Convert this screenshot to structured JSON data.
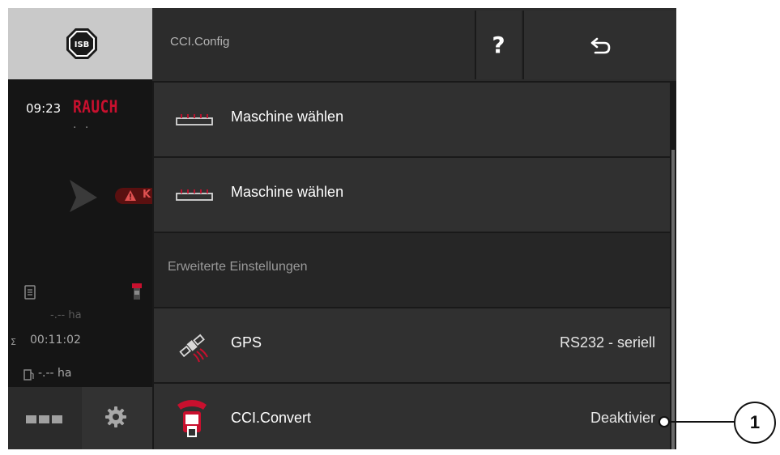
{
  "colors": {
    "brand": "#c8102e",
    "isb_tile": "#c9c9c9",
    "header_bg": "#2c2c2c",
    "row_bg": "#303030",
    "section_bg": "#262626",
    "text_primary": "#ffffff"
  },
  "sidebar": {
    "isb_label": "ISB",
    "time": "09:23",
    "brand": "RAUCH",
    "dots": "· ·",
    "alarm_text": "K",
    "area_top": "-.-- ha",
    "counter_symbol": "Σ",
    "counter": "00:11:02",
    "area_bottom": "-.-- ha",
    "icons": [
      "isb-icon",
      "navigation-arrow-icon",
      "warning-icon",
      "document-icon",
      "sprayer-icon",
      "sum-counter-icon",
      "fuel-icon",
      "grid-menu-icon",
      "gear-icon"
    ]
  },
  "header": {
    "title": "CCI.Config",
    "help_label": "?",
    "back_icon": "back-arrow-icon"
  },
  "list": {
    "items": [
      {
        "label": "Maschine wählen",
        "icon": "implement-icon"
      },
      {
        "label": "Maschine wählen",
        "icon": "implement-icon"
      }
    ],
    "section_label": "Erweiterte Einstellungen",
    "settings": [
      {
        "label": "GPS",
        "value": "RS232 - seriell",
        "icon": "gps-satellite-icon"
      },
      {
        "label": "CCI.Convert",
        "value": "Deaktivier",
        "icon": "tractor-convert-icon"
      }
    ]
  },
  "callout": {
    "number": "1"
  }
}
